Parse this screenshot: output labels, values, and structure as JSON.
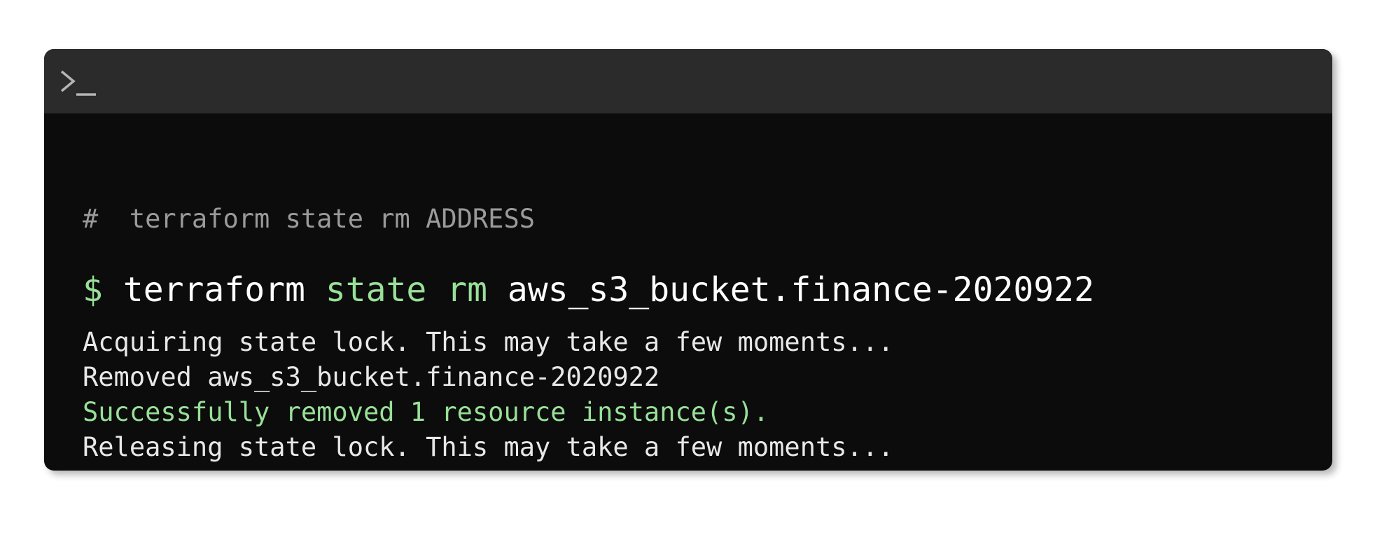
{
  "terminal": {
    "prompt_icon": "terminal-prompt-icon",
    "comment": "#  terraform state rm ADDRESS",
    "command": {
      "prompt": "$",
      "program": "terraform",
      "subcommand": "state rm",
      "argument": "aws_s3_bucket.finance-2020922"
    },
    "output": [
      {
        "text": "Acquiring state lock. This may take a few moments...",
        "status": "normal"
      },
      {
        "text": "Removed aws_s3_bucket.finance-2020922",
        "status": "normal"
      },
      {
        "text": "Successfully removed 1 resource instance(s).",
        "status": "success"
      },
      {
        "text": "Releasing state lock. This may take a few moments...",
        "status": "normal"
      }
    ]
  },
  "colors": {
    "background": "#0c0c0c",
    "titlebar": "#2b2b2b",
    "accent_green": "#98e098",
    "comment_gray": "#9a9a9a",
    "text": "#e8e8e8"
  }
}
